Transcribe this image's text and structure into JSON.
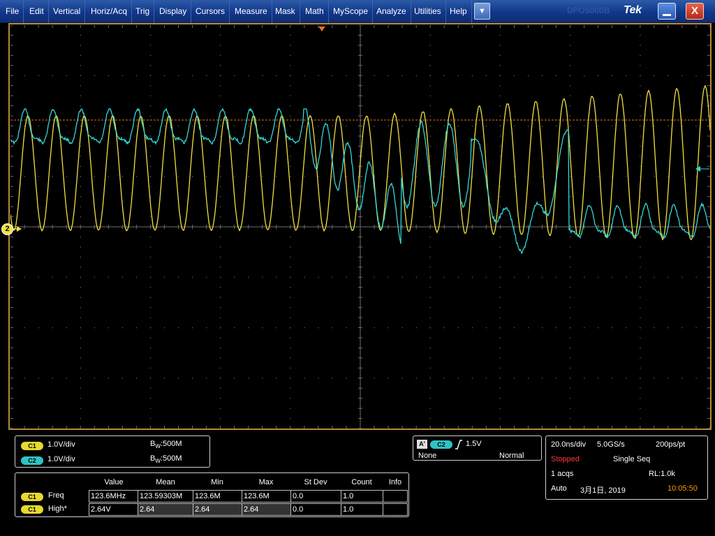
{
  "menubar": {
    "items": [
      "File",
      "Edit",
      "Vertical",
      "Horiz/Acq",
      "Trig",
      "Display",
      "Cursors",
      "Measure",
      "Mask",
      "Math",
      "MyScope",
      "Analyze",
      "Utilities",
      "Help"
    ],
    "dropdown_glyph": "▼",
    "brand": "Tek",
    "brand_ghost": "DPO5000B",
    "close_glyph": "X"
  },
  "display": {
    "colors": {
      "background": "#000000",
      "grid": "#6e6e6e",
      "ch1": "#f0e040",
      "ch2": "#35d6d6",
      "trigger_level": "#e07020",
      "frame": "#b58a3a"
    },
    "ch2_marker": "2",
    "icons": [
      "trigger-position-icon",
      "ch2-ground-marker-icon",
      "trigger-level-arrow-icon"
    ]
  },
  "channels": [
    {
      "badge": "C1",
      "scale": "1.0V/div",
      "bw_label": "B",
      "bw_sub": "W",
      "bw_value": ":500M"
    },
    {
      "badge": "C2",
      "scale": "1.0V/div",
      "bw_label": "B",
      "bw_sub": "W",
      "bw_value": ":500M"
    }
  ],
  "trigger": {
    "a_label": "A'",
    "source": "C2",
    "slope_icon": "rising-edge-icon",
    "level": "1.5V",
    "coupling": "None",
    "mode": "Normal"
  },
  "acquisition": {
    "timebase": "20.0ns/div",
    "sample_rate": "5.0GS/s",
    "resolution": "200ps/pt",
    "status": "Stopped",
    "status_color": "#ff3a3a",
    "mode": "Single Seq",
    "acqs": "1 acqs",
    "record_length": "RL:1.0k",
    "trigger_mode": "Auto",
    "date": "3月1日, 2019",
    "time": "10:05:50",
    "time_color": "#ff9900"
  },
  "measurements": {
    "headers": [
      "Value",
      "Mean",
      "Min",
      "Max",
      "St Dev",
      "Count",
      "Info"
    ],
    "rows": [
      {
        "badge": "C1",
        "name": "Freq",
        "cells": [
          "123.6MHz",
          "123.59303M",
          "123.6M",
          "123.6M",
          "0.0",
          "1.0",
          ""
        ]
      },
      {
        "badge": "C1",
        "name": "High*",
        "cells": [
          "2.64V",
          "2.64",
          "2.64",
          "2.64",
          "0.0",
          "1.0",
          ""
        ]
      }
    ]
  }
}
